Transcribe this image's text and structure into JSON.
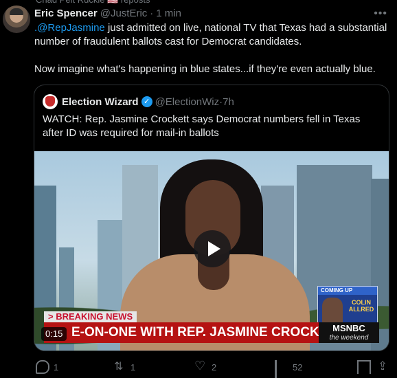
{
  "retweet_banner": "Chad Pelt Ruckle 🇺🇸 reposts",
  "tweet": {
    "author_name": "Eric Spencer",
    "author_handle": "@JustEric",
    "separator": "·",
    "time": "1 min",
    "mention": ".@RepJasmine",
    "text_line1": " just admitted on live, national TV that Texas had a substantial number of fraudulent ballots cast for Democrat candidates.",
    "text_line2": "Now imagine what's happening in blue states...if they're even actually blue."
  },
  "quoted": {
    "author_name": "Election Wizard",
    "author_handle": "@ElectionWiz",
    "separator": "·",
    "time": "7h",
    "verified": "✓",
    "text": "WATCH: Rep. Jasmine Crockett says Democrat numbers fell in Texas after ID was required for mail-in ballots"
  },
  "video": {
    "breaking": "> BREAKING NEWS",
    "lower_third": "E-ON-ONE WITH REP. JASMINE CROCKETT",
    "network": "MSNBC",
    "network_sub": "the weekend",
    "coming_up_label": "COMING UP",
    "coming_up_name": "COLIN ALLRED",
    "timestamp": "0:15"
  },
  "actions": {
    "replies": "1",
    "reposts": "1",
    "likes": "2",
    "views": "52"
  },
  "icons": {
    "more": "more-icon",
    "reply": "reply-icon",
    "retweet": "retweet-icon",
    "like": "heart-icon",
    "views": "views-icon",
    "bookmark": "bookmark-icon",
    "share": "share-icon",
    "play": "play-icon"
  },
  "colors": {
    "accent": "#1d9bf0",
    "muted": "#71767b",
    "background": "#000000",
    "breaking_red": "#b51212"
  }
}
